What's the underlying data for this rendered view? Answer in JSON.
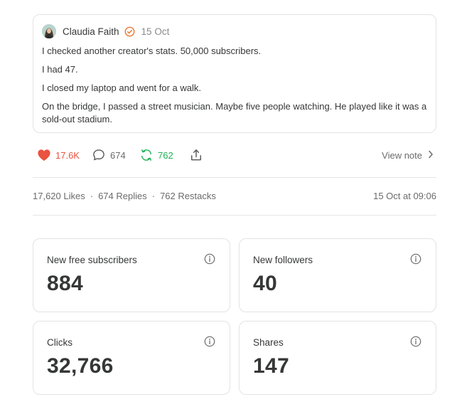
{
  "note": {
    "author": "Claudia Faith",
    "date": "15 Oct",
    "paragraphs": [
      "I checked another creator's stats. 50,000 subscribers.",
      "I had 47.",
      "I closed my laptop and went for a walk.",
      "On the bridge, I passed a street musician. Maybe five people watching. He played like it was a sold-out stadium."
    ]
  },
  "actions": {
    "likes": "17.6K",
    "replies": "674",
    "restacks": "762",
    "view_note": "View note"
  },
  "stats": {
    "likes": "17,620 Likes",
    "replies": "674 Replies",
    "restacks": "762 Restacks",
    "separator": "·",
    "timestamp": "15 Oct at 09:06"
  },
  "metrics": [
    {
      "label": "New free subscribers",
      "value": "884"
    },
    {
      "label": "New followers",
      "value": "40"
    },
    {
      "label": "Clicks",
      "value": "32,766"
    },
    {
      "label": "Shares",
      "value": "147"
    }
  ],
  "icons": {
    "verified": "verified-check-icon",
    "like": "heart-icon",
    "reply": "comment-icon",
    "restack": "restack-icon",
    "share": "share-icon",
    "view_note": "chevron-right-icon",
    "info": "info-icon"
  },
  "colors": {
    "like": "#e9533f",
    "restack": "#1db455",
    "verified": "#e8762d",
    "text": "#363737",
    "muted": "#6b6b6b"
  }
}
